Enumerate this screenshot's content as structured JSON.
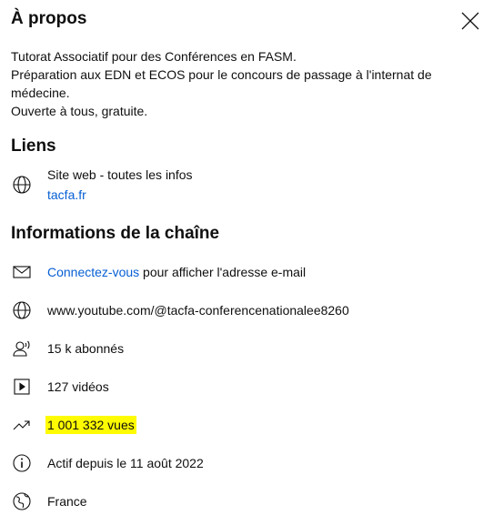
{
  "about": {
    "title": "À propos",
    "description": [
      "Tutorat Associatif pour des Conférences en FASM.",
      "Préparation aux EDN et ECOS pour le concours de passage à l'internat de",
      "médecine.",
      "Ouverte à tous, gratuite."
    ]
  },
  "links": {
    "heading": "Liens",
    "items": [
      {
        "title": "Site web - toutes les infos",
        "url": "tacfa.fr"
      }
    ]
  },
  "channel_info": {
    "heading": "Informations de la chaîne",
    "signin_link": "Connectez-vous",
    "signin_suffix": " pour afficher l'adresse e-mail",
    "url": "www.youtube.com/@tacfa-conferencenationalee8260",
    "subscribers": "15 k abonnés",
    "videos": "127 vidéos",
    "views": "1 001 332 vues",
    "joined": "Actif depuis le 11 août 2022",
    "country": "France"
  },
  "icons": {
    "close": "close-icon",
    "globe": "globe-icon",
    "mail": "mail-icon",
    "subscribers": "person-radio-icon",
    "videos": "play-box-icon",
    "views": "trending-icon",
    "info": "info-icon",
    "country": "globe-icon"
  },
  "colors": {
    "link": "#065fd4",
    "highlight": "#fffb00"
  }
}
